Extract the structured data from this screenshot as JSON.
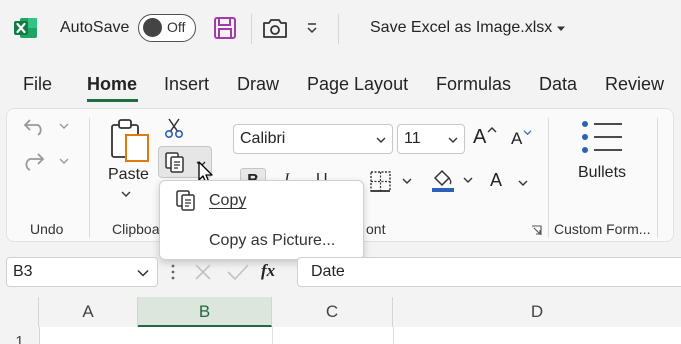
{
  "titlebar": {
    "app_icon": "excel-logo-icon",
    "autosave_label": "AutoSave",
    "autosave_state": "Off",
    "file_title": "Save Excel as Image.xlsx"
  },
  "menu": {
    "tabs": [
      "File",
      "Home",
      "Insert",
      "Draw",
      "Page Layout",
      "Formulas",
      "Data",
      "Review"
    ],
    "active": "Home"
  },
  "ribbon": {
    "groups": {
      "undo": "Undo",
      "clipboard": "Clipboa",
      "font": "ont",
      "custom_formatting": "Custom Form..."
    },
    "paste_label": "Paste",
    "font_name": "Calibri",
    "font_size": "11",
    "bold_label": "B",
    "italic_label": "I",
    "underline_label": "U",
    "font_color_label": "A",
    "grow_font_label": "A",
    "shrink_font_label": "A",
    "bullets_label": "Bullets"
  },
  "context_menu": {
    "items": [
      "Copy",
      "Copy as Picture..."
    ]
  },
  "formula_bar": {
    "name_box": "B3",
    "fx_label": "fx",
    "content": "Date"
  },
  "grid": {
    "columns": [
      "A",
      "B",
      "C",
      "D"
    ],
    "selected_column": "B",
    "rows": [
      "1"
    ]
  },
  "colors": {
    "excel_green": "#1e6c41",
    "save_purple": "#a03ca8",
    "accent_orange": "#e07a10",
    "accent_blue": "#2b62b5"
  }
}
